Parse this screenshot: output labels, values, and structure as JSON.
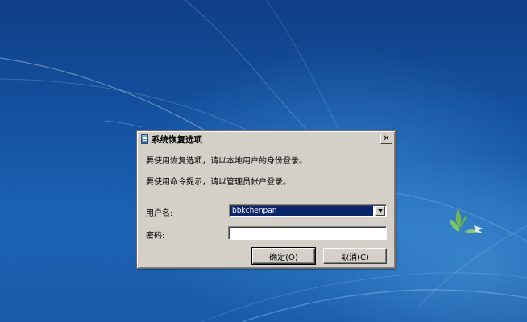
{
  "dialog": {
    "title": "系统恢复选项",
    "close_glyph": "✕",
    "message_recovery": "要使用恢复选项，请以本地用户的身份登录。",
    "message_cmd": "要使用命令提示，请以管理员帐户登录。",
    "username_label": "用户名:",
    "username_value": "bbkchenpan",
    "password_label": "密码:",
    "password_value": "",
    "ok_label": "确定(O)",
    "cancel_label": "取消(C)"
  },
  "icons": {
    "title": "system-recovery-icon",
    "close": "close-icon",
    "dropdown": "chevron-down-icon",
    "logo": "windows-7-logo"
  },
  "colors": {
    "dialog_bg": "#d4d0c8",
    "selection_bg": "#0a246a",
    "desktop_blue": "#1656a6"
  }
}
